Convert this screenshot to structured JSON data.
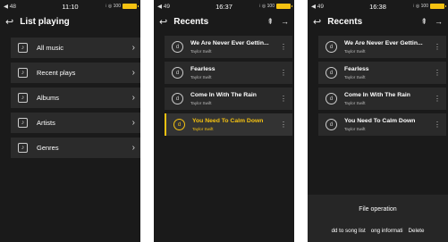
{
  "screens": [
    {
      "status": {
        "left": "◀ 48",
        "time": "11:10",
        "right": "⁝ ◎ 100"
      },
      "header": {
        "title": "List playing"
      },
      "menu": [
        {
          "label": "All music"
        },
        {
          "label": "Recent plays"
        },
        {
          "label": "Albums"
        },
        {
          "label": "Artists"
        },
        {
          "label": "Genres"
        }
      ]
    },
    {
      "status": {
        "left": "◀ 49",
        "time": "16:37",
        "right": "⁝ ◎ 100"
      },
      "header": {
        "title": "Recents"
      },
      "songs": [
        {
          "title": "We Are Never Ever Gettin...",
          "artist": "Taylor Swift"
        },
        {
          "title": "Fearless",
          "artist": "Taylor Swift"
        },
        {
          "title": "Come In With The Rain",
          "artist": "Taylor Swift"
        },
        {
          "title": "You Need To Calm Down",
          "artist": "Taylor Swift",
          "active": true
        }
      ]
    },
    {
      "status": {
        "left": "◀ 49",
        "time": "16:38",
        "right": "⁝ ◎ 100"
      },
      "header": {
        "title": "Recents"
      },
      "songs": [
        {
          "title": "We Are Never Ever Gettin...",
          "artist": "Taylor Swift"
        },
        {
          "title": "Fearless",
          "artist": "Taylor Swift"
        },
        {
          "title": "Come In With The Rain",
          "artist": "Taylor Swift"
        },
        {
          "title": "You Need To Calm Down",
          "artist": "Taylor Swift"
        }
      ],
      "sheet": {
        "title": "File operation",
        "options": [
          "dd to song list",
          "ong informati",
          "Delete"
        ]
      }
    }
  ],
  "colors": {
    "accent": "#f5c211",
    "background": "#1a1a1a"
  }
}
